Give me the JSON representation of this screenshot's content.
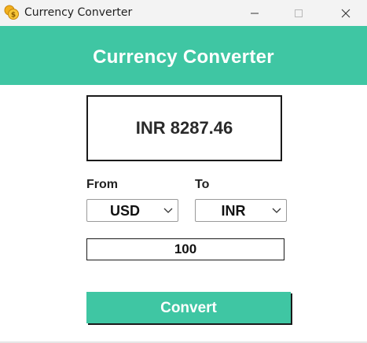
{
  "window": {
    "title": "Currency Converter",
    "app_icon": "coin-dollar-icon",
    "controls": [
      "minimize-icon",
      "maximize-icon",
      "close-icon"
    ]
  },
  "header": {
    "title": "Currency Converter"
  },
  "result": {
    "text": "INR 8287.46"
  },
  "form": {
    "from_label": "From",
    "to_label": "To",
    "from_value": "USD",
    "to_value": "INR",
    "amount": "100",
    "convert_label": "Convert"
  },
  "colors": {
    "accent": "#3fc6a3",
    "text_dark": "#222222",
    "button_text": "#ffffff"
  }
}
